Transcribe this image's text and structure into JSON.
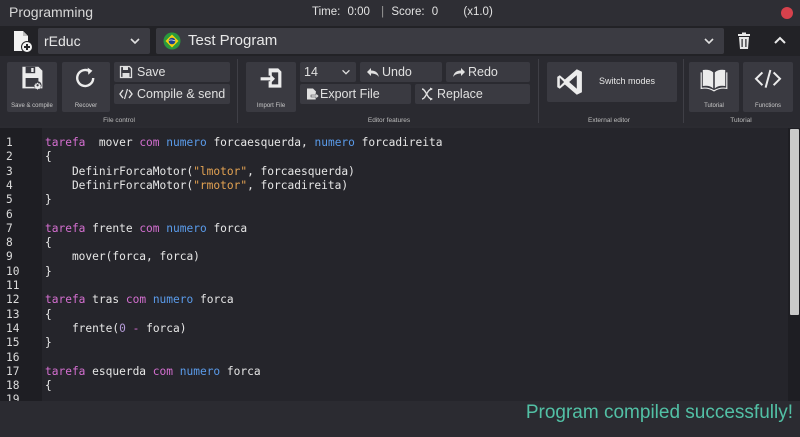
{
  "window": {
    "title": "Programming",
    "time_label": "Time:",
    "time_value": "0:00",
    "score_label": "Score:",
    "score_value": "0",
    "multiplier": "(x1.0)"
  },
  "selectors": {
    "language": "rEduc",
    "program": "Test Program"
  },
  "toolbar": {
    "file_control": {
      "group_label": "File control",
      "save_compile_label": "Save & compile",
      "recover_label": "Recover",
      "save_label": "Save",
      "compile_send_label": "Compile & send"
    },
    "editor_features": {
      "group_label": "Editor features",
      "import_file_label": "Import File",
      "font_size": "14",
      "undo_label": "Undo",
      "redo_label": "Redo",
      "export_file_label": "Export File",
      "replace_label": "Replace"
    },
    "external_editor": {
      "group_label": "External editor",
      "switch_modes_label": "Switch modes"
    },
    "tutorial": {
      "group_label": "Tutorial",
      "tutorial_label": "Tutorial",
      "functions_label": "Functions"
    }
  },
  "editor": {
    "line_numbers": [
      "1",
      "2",
      "3",
      "4",
      "5",
      "6",
      "7",
      "8",
      "9",
      "10",
      "11",
      "12",
      "13",
      "14",
      "15",
      "16",
      "17",
      "18",
      "19"
    ],
    "lines": [
      [
        [
          "kw",
          "tarefa"
        ],
        [
          "",
          "  mover "
        ],
        [
          "kw",
          "com"
        ],
        [
          "",
          " "
        ],
        [
          "ty",
          "numero"
        ],
        [
          "",
          " forcaesquerda, "
        ],
        [
          "ty",
          "numero"
        ],
        [
          "",
          " forcadireita"
        ]
      ],
      [
        [
          "",
          "{"
        ]
      ],
      [
        [
          "",
          "    DefinirForcaMotor("
        ],
        [
          "str",
          "\"lmotor\""
        ],
        [
          "",
          ", forcaesquerda)"
        ]
      ],
      [
        [
          "",
          "    DefinirForcaMotor("
        ],
        [
          "str",
          "\"rmotor\""
        ],
        [
          "",
          ", forcadireita)"
        ]
      ],
      [
        [
          "",
          "}"
        ]
      ],
      [
        [
          "",
          ""
        ]
      ],
      [
        [
          "kw",
          "tarefa"
        ],
        [
          "",
          " frente "
        ],
        [
          "kw",
          "com"
        ],
        [
          "",
          " "
        ],
        [
          "ty",
          "numero"
        ],
        [
          "",
          " forca"
        ]
      ],
      [
        [
          "",
          "{"
        ]
      ],
      [
        [
          "",
          "    mover(forca, forca)"
        ]
      ],
      [
        [
          "",
          "}"
        ]
      ],
      [
        [
          "",
          ""
        ]
      ],
      [
        [
          "kw",
          "tarefa"
        ],
        [
          "",
          " tras "
        ],
        [
          "kw",
          "com"
        ],
        [
          "",
          " "
        ],
        [
          "ty",
          "numero"
        ],
        [
          "",
          " forca"
        ]
      ],
      [
        [
          "",
          "{"
        ]
      ],
      [
        [
          "",
          "    frente("
        ],
        [
          "num",
          "0"
        ],
        [
          "",
          " "
        ],
        [
          "op",
          "-"
        ],
        [
          "",
          " forca)"
        ]
      ],
      [
        [
          "",
          "}"
        ]
      ],
      [
        [
          "",
          ""
        ]
      ],
      [
        [
          "kw",
          "tarefa"
        ],
        [
          "",
          " esquerda "
        ],
        [
          "kw",
          "com"
        ],
        [
          "",
          " "
        ],
        [
          "ty",
          "numero"
        ],
        [
          "",
          " forca"
        ]
      ],
      [
        [
          "",
          "{"
        ]
      ],
      [
        [
          "",
          ""
        ]
      ]
    ]
  },
  "status": {
    "message": "Program compiled successfully!"
  },
  "colors": {
    "keyword": "#d46fd0",
    "type": "#5a9bea",
    "string": "#e3a252",
    "status_success": "#52c0a5",
    "close_button": "#d6414c"
  }
}
